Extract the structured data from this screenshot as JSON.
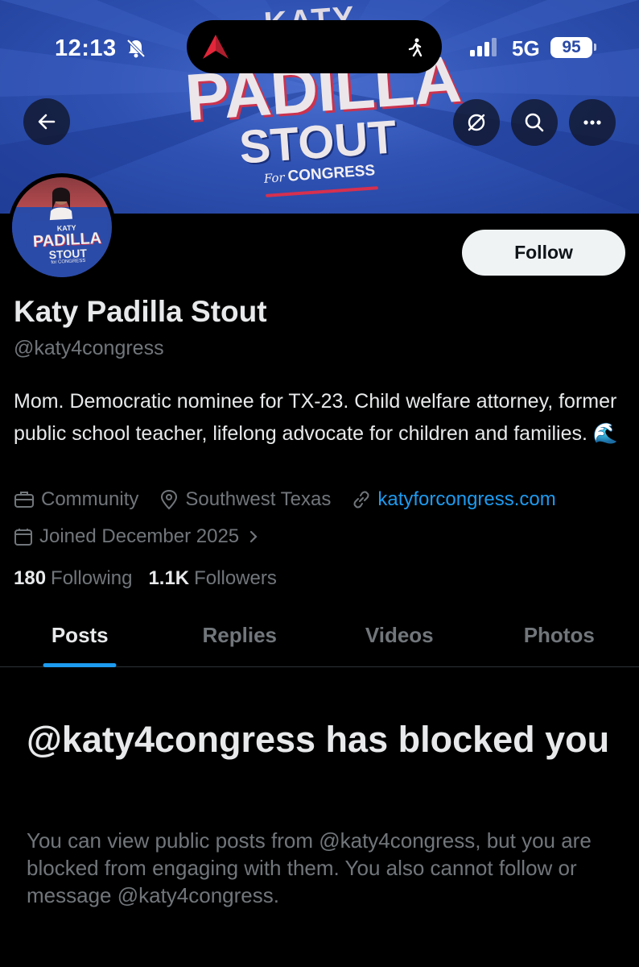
{
  "status_bar": {
    "time": "12:13",
    "network": "5G",
    "battery": "95"
  },
  "banner": {
    "line_top": "KATY",
    "line_name": "PADILLA",
    "line_surname": "STOUT",
    "for_text": "For",
    "congress_text": "CONGRESS"
  },
  "avatar": {
    "sign_top": "KATY",
    "sign_name": "PADILLA",
    "sign_surname": "STOUT",
    "sign_congress": "for CONGRESS"
  },
  "profile": {
    "follow_label": "Follow",
    "display_name": "Katy Padilla Stout",
    "handle": "@katy4congress",
    "bio": "Mom. Democratic nominee for TX-23. Child welfare attorney, former public school teacher, lifelong advocate for children and families. 🌊",
    "category": "Community",
    "location": "Southwest Texas",
    "website": "katyforcongress.com",
    "joined": "Joined December 2025",
    "following_count": "180",
    "following_label": "Following",
    "followers_count": "1.1K",
    "followers_label": "Followers"
  },
  "tabs": [
    "Posts",
    "Replies",
    "Videos",
    "Photos"
  ],
  "blocked": {
    "title": "@katy4congress has blocked you",
    "description": "You can view public posts from @katy4congress, but you are blocked from engaging with them. You also cannot follow or message @katy4congress."
  },
  "colors": {
    "accent": "#1d9bf0",
    "banner_blue": "#2f52b3",
    "banner_red": "#c9334f",
    "muted": "#71767b"
  },
  "icons": [
    "bell-slash-icon",
    "airline-logo-icon",
    "walking-icon",
    "signal-icon",
    "back-arrow-icon",
    "translate-icon",
    "search-icon",
    "more-icon",
    "briefcase-icon",
    "location-pin-icon",
    "link-icon",
    "calendar-icon",
    "chevron-right-icon"
  ]
}
